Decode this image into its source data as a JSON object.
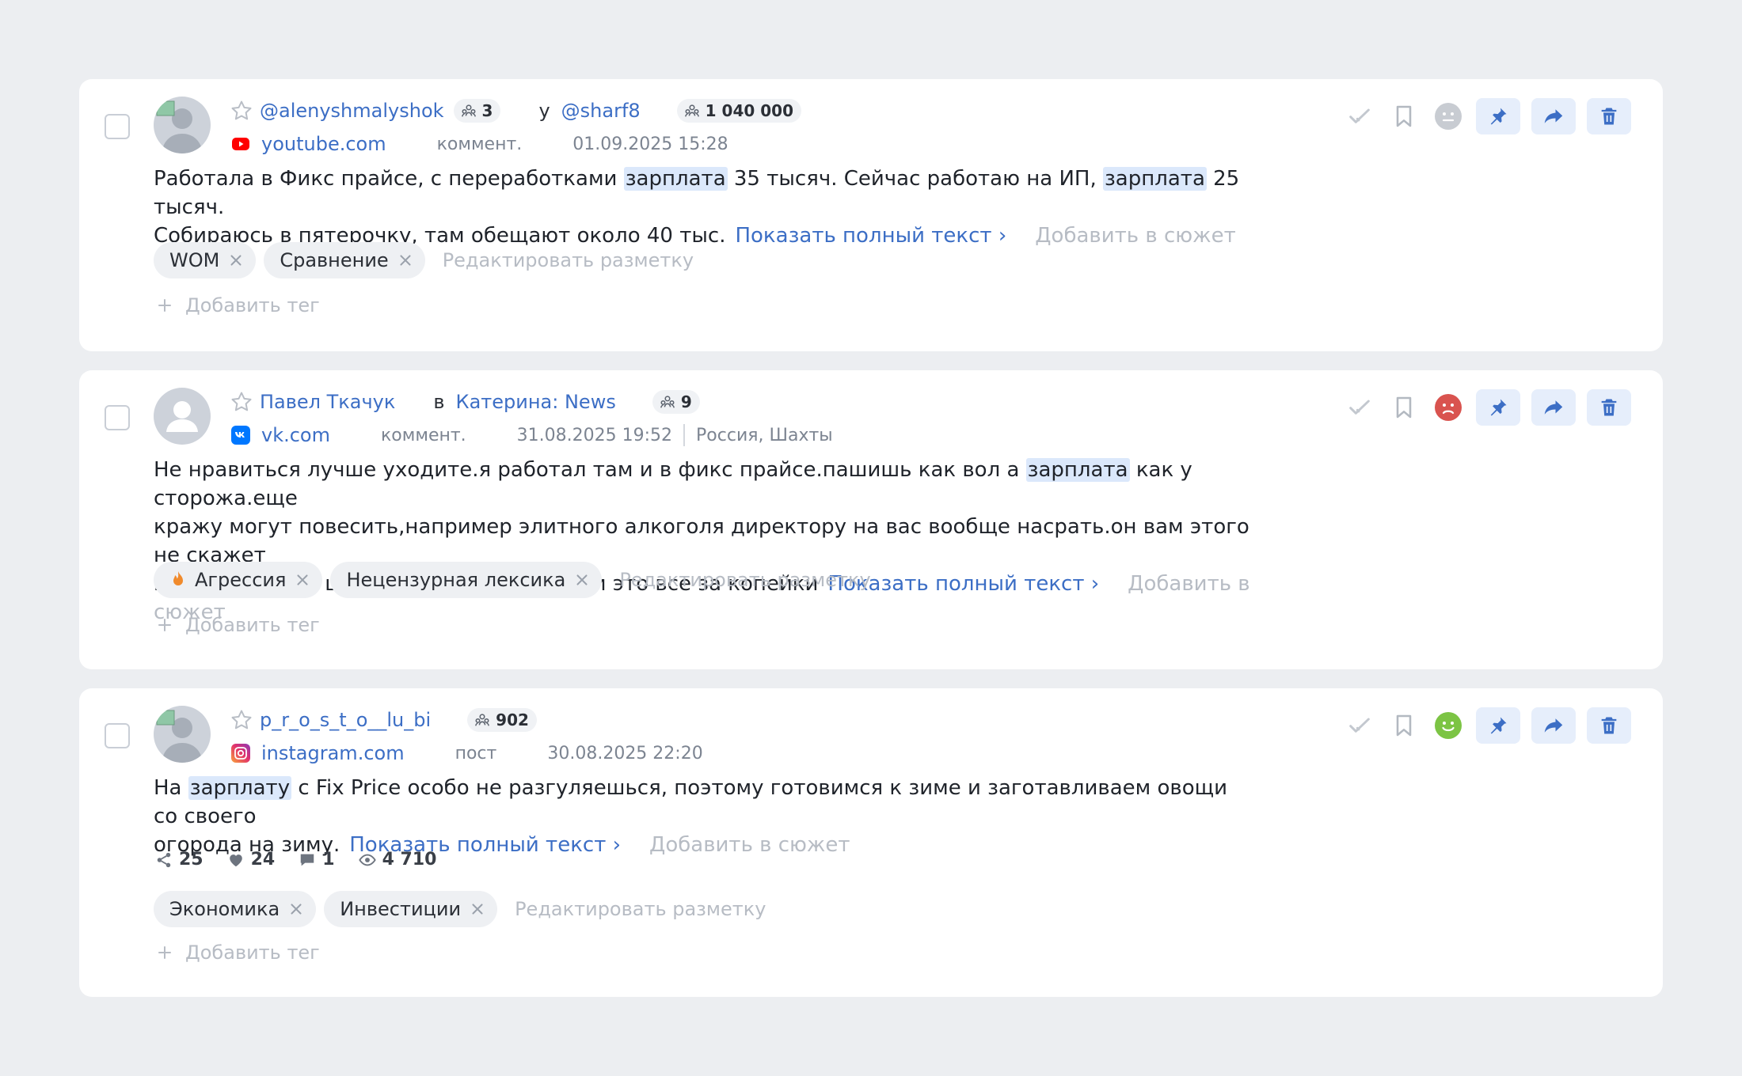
{
  "labels": {
    "show_full_text": "Показать полный текст",
    "chevron_right": "›",
    "add_to_story": "Добавить в сюжет",
    "edit_markup": "Редактировать разметку",
    "add_tag": "Добавить тег",
    "plus": "+"
  },
  "colors": {
    "accent": "#3c6ec5",
    "highlight": "#dbe8fb",
    "sentiment_neutral": "#c8ccd2",
    "sentiment_negative": "#d9534f",
    "sentiment_positive": "#7cc444"
  },
  "posts": [
    {
      "author": "@alenyshmalyshok",
      "author_audience": "3",
      "relation_word": "у",
      "target": "@sharf8",
      "target_audience": "1 040 000",
      "source": "youtube.com",
      "source_icon": "youtube-icon",
      "type": "коммент.",
      "datetime": "01.09.2025 15:28",
      "text_parts": [
        "Работала в Фикс прайсе, с переработками ",
        "зарплата",
        " 35 тысяч. Сейчас работаю на ИП, ",
        "зарплата",
        " 25 тысяч.",
        "Собираюсь в пятерочку, там обещают около 40 тыс."
      ],
      "tags": [
        "WOM",
        "Сравнение"
      ],
      "sentiment": "neutral"
    },
    {
      "author": "Павел Ткачук",
      "relation_word": "в",
      "target": "Катерина: News",
      "target_audience": "9",
      "source": "vk.com",
      "source_icon": "vk-icon",
      "type": "коммент.",
      "datetime": "31.08.2025 19:52",
      "location": "Россия, Шахты",
      "text_parts": [
        "Не нравиться лучше уходите.я работал там и в фикс прайсе.пашишь как вол а ",
        "зарплата",
        " как у сторожа.еще",
        "кражу могут повесить,например элитного алкоголя директору на вас вообще насрать.он вам этого не скажет",
        "но по факту на шее сидит и не сливает.и это все за копейки"
      ],
      "tags": [
        "Агрессия",
        "Нецензурная лексика"
      ],
      "sentiment": "negative"
    },
    {
      "author": "p_r_o_s_t_o__lu_bi",
      "author_audience": "902",
      "source": "instagram.com",
      "source_icon": "instagram-icon",
      "type": "пост",
      "datetime": "30.08.2025 22:20",
      "text_parts": [
        "На ",
        "зарплату",
        " с Fix Price особо не разгуляешься, поэтому готовимся к зиме и заготавливаем овощи со своего",
        "огорода на зиму."
      ],
      "stats": {
        "reposts": "25",
        "likes": "24",
        "comments": "1",
        "views": "4 710"
      },
      "tags": [
        "Экономика",
        "Инвестиции"
      ],
      "sentiment": "positive"
    }
  ]
}
